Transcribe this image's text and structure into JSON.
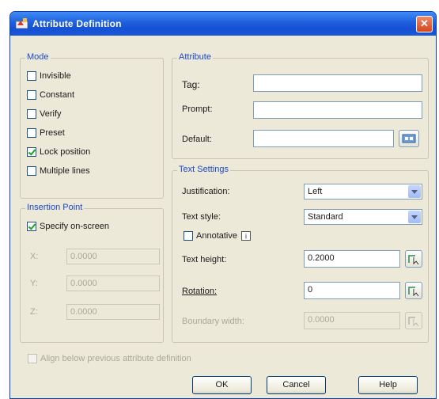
{
  "window": {
    "title": "Attribute Definition",
    "close_symbol": "✕"
  },
  "mode": {
    "title": "Mode",
    "items": [
      {
        "label": "Invisible",
        "checked": false
      },
      {
        "label": "Constant",
        "checked": false
      },
      {
        "label": "Verify",
        "checked": false
      },
      {
        "label": "Preset",
        "checked": false
      },
      {
        "label": "Lock position",
        "checked": true
      },
      {
        "label": "Multiple lines",
        "checked": false
      }
    ]
  },
  "insertion_point": {
    "title": "Insertion Point",
    "specify_label": "Specify on-screen",
    "specify_checked": true,
    "x_label": "X:",
    "x_value": "0.0000",
    "y_label": "Y:",
    "y_value": "0.0000",
    "z_label": "Z:",
    "z_value": "0.0000"
  },
  "attribute": {
    "title": "Attribute",
    "tag_label": "Tag:",
    "tag_value": "",
    "prompt_label": "Prompt:",
    "prompt_value": "",
    "default_label": "Default:",
    "default_value": ""
  },
  "text_settings": {
    "title": "Text Settings",
    "justification_label": "Justification:",
    "justification_value": "Left",
    "text_style_label": "Text style:",
    "text_style_value": "Standard",
    "annotative_label": "Annotative",
    "annotative_checked": false,
    "text_height_label": "Text height:",
    "text_height_value": "0.2000",
    "rotation_label": "Rotation:",
    "rotation_value": "0",
    "boundary_width_label": "Boundary width:",
    "boundary_width_value": "0.0000"
  },
  "align_below": {
    "label": "Align below previous attribute definition",
    "checked": false
  },
  "buttons": {
    "ok": "OK",
    "cancel": "Cancel",
    "help": "Help"
  },
  "colors": {
    "titlebar": "#1f5fdc",
    "dialog_bg": "#ece9d8",
    "group_title": "#1a47c8",
    "close": "#d4451e"
  }
}
